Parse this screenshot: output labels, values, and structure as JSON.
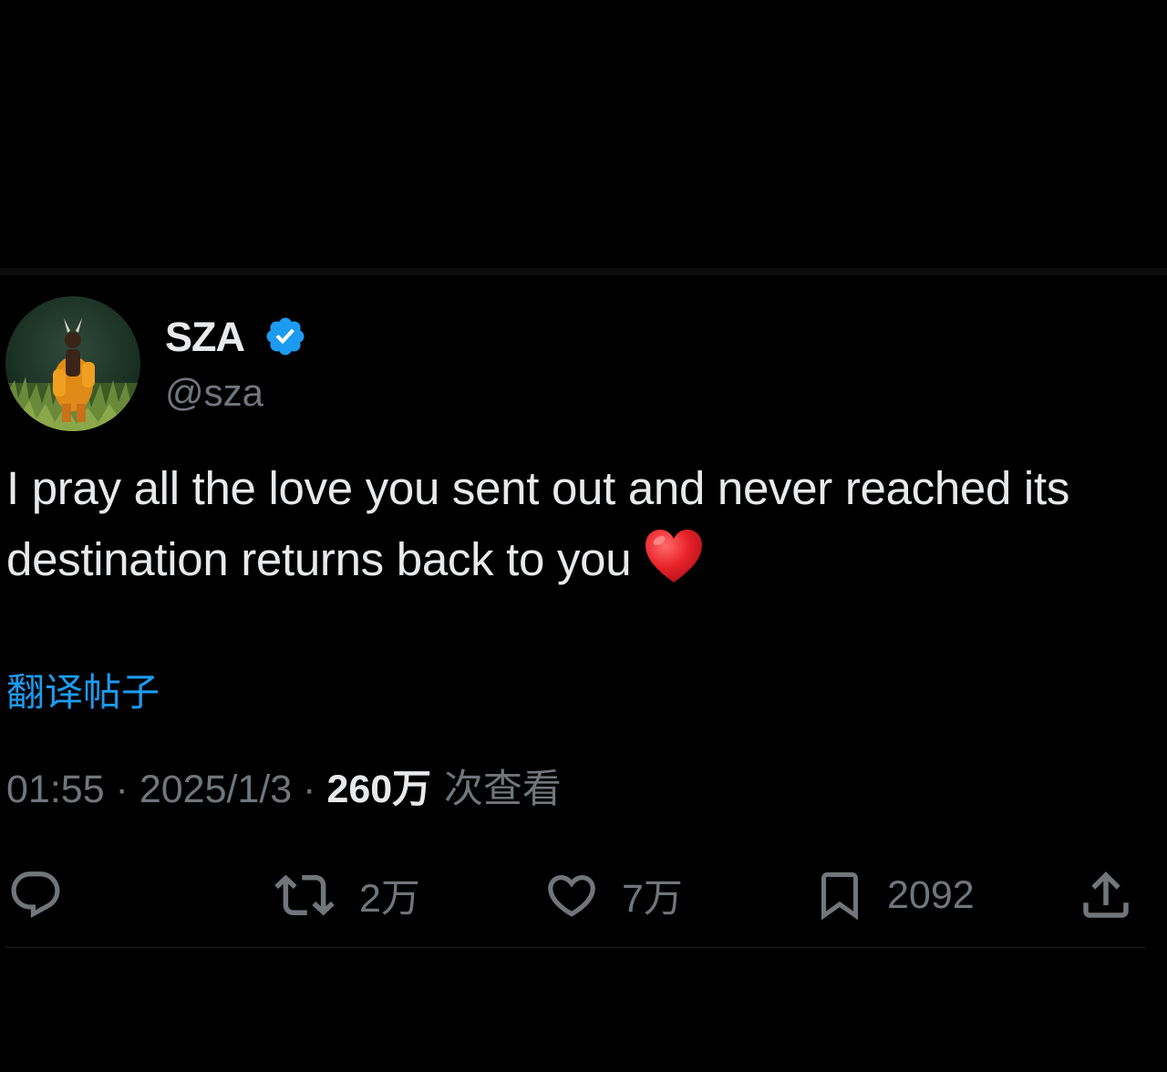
{
  "author": {
    "display_name": "SZA",
    "handle": "@sza",
    "verified": true,
    "verified_color": "#1d9bf0"
  },
  "tweet": {
    "text": "I pray all the love you sent out and never reached its destination returns back to you",
    "emoji": "heart-emoji"
  },
  "translate": {
    "label": "翻译帖子"
  },
  "meta": {
    "time": "01:55",
    "separator": " · ",
    "date": "2025/1/3",
    "views_count": "260万",
    "views_label": " 次查看"
  },
  "actions": {
    "reply": {
      "icon": "reply-icon",
      "count": ""
    },
    "retweet": {
      "icon": "retweet-icon",
      "count": "2万"
    },
    "like": {
      "icon": "heart-icon",
      "count": "7万"
    },
    "bookmark": {
      "icon": "bookmark-icon",
      "count": "2092"
    },
    "share": {
      "icon": "share-icon",
      "count": ""
    }
  },
  "colors": {
    "background": "#000000",
    "text_primary": "#e7e9ea",
    "text_secondary": "#71767b",
    "accent": "#1d9bf0"
  }
}
